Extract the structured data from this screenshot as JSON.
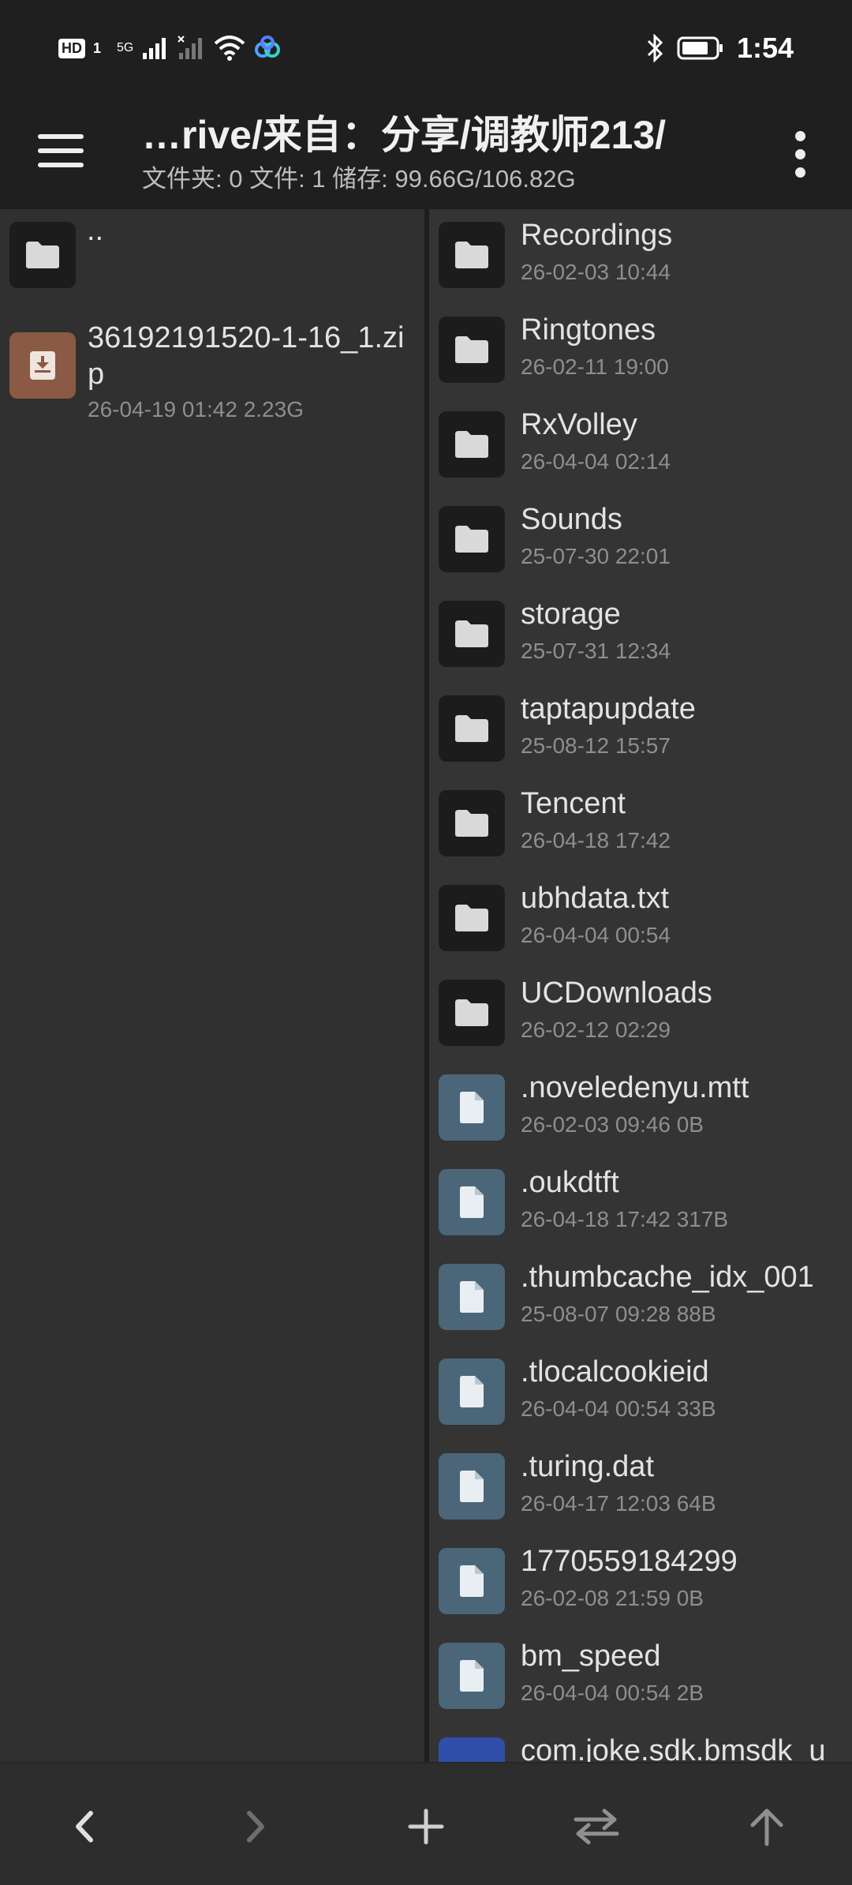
{
  "status_bar": {
    "hd_label": "HD",
    "sim_label": "1",
    "network_label": "5G",
    "time": "1:54",
    "icons": [
      "hd-icon",
      "signal-icon",
      "signal-x-icon",
      "wifi-icon",
      "app-cloud-icon",
      "bluetooth-icon",
      "battery-icon"
    ]
  },
  "app_bar": {
    "title": "…rive/来自：分享/调教师213/",
    "subtitle": "文件夹: 0  文件: 1  储存: 99.66G/106.82G"
  },
  "left_pane": {
    "parent": {
      "label": ".."
    },
    "items": [
      {
        "name": "36192191520-1-16_1.zip",
        "meta": "26-04-19 01:42  2.23G",
        "type": "zip"
      }
    ]
  },
  "right_pane": {
    "items": [
      {
        "name": "Recordings",
        "meta": "26-02-03 10:44",
        "type": "folder"
      },
      {
        "name": "Ringtones",
        "meta": "26-02-11 19:00",
        "type": "folder"
      },
      {
        "name": "RxVolley",
        "meta": "26-04-04 02:14",
        "type": "folder"
      },
      {
        "name": "Sounds",
        "meta": "25-07-30 22:01",
        "type": "folder"
      },
      {
        "name": "storage",
        "meta": "25-07-31 12:34",
        "type": "folder"
      },
      {
        "name": "taptapupdate",
        "meta": "25-08-12 15:57",
        "type": "folder"
      },
      {
        "name": "Tencent",
        "meta": "26-04-18 17:42",
        "type": "folder"
      },
      {
        "name": "ubhdata.txt",
        "meta": "26-04-04 00:54",
        "type": "folder"
      },
      {
        "name": "UCDownloads",
        "meta": "26-02-12 02:29",
        "type": "folder"
      },
      {
        "name": ".noveledenyu.mtt",
        "meta": "26-02-03 09:46  0B",
        "type": "file"
      },
      {
        "name": ".oukdtft",
        "meta": "26-04-18 17:42  317B",
        "type": "file"
      },
      {
        "name": ".thumbcache_idx_001",
        "meta": "25-08-07 09:28  88B",
        "type": "file"
      },
      {
        "name": ".tlocalcookieid",
        "meta": "26-04-04 00:54  33B",
        "type": "file"
      },
      {
        "name": ".turing.dat",
        "meta": "26-04-17 12:03  64B",
        "type": "file"
      },
      {
        "name": "1770559184299",
        "meta": "26-02-08 21:59  0B",
        "type": "file"
      },
      {
        "name": "bm_speed",
        "meta": "26-04-04 00:54  2B",
        "type": "file"
      },
      {
        "name": "com.joke.sdk.bmsdk_u",
        "meta": "",
        "type": "bluefile"
      }
    ]
  },
  "bottom_bar": {
    "buttons": [
      "back-icon",
      "forward-icon",
      "add-icon",
      "swap-icon",
      "up-icon"
    ]
  }
}
